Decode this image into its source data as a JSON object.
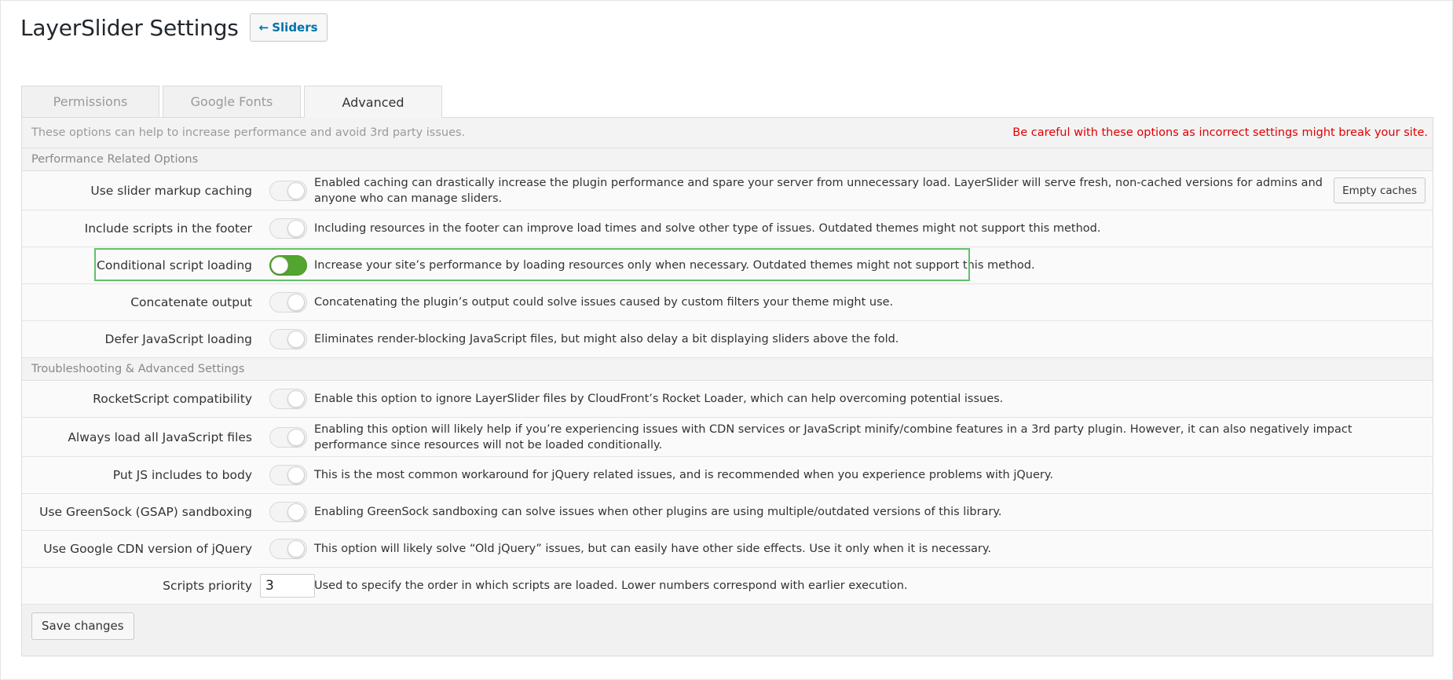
{
  "header": {
    "title": "LayerSlider Settings",
    "back_label": "Sliders",
    "back_arrow": "←"
  },
  "tabs": [
    {
      "label": "Permissions",
      "active": false
    },
    {
      "label": "Google Fonts",
      "active": false
    },
    {
      "label": "Advanced",
      "active": true
    }
  ],
  "notice": {
    "info": "These options can help to increase performance and avoid 3rd party issues.",
    "warning": "Be careful with these options as incorrect settings might break your site.",
    "warning_color": "#e00000"
  },
  "sections": {
    "performance": "Performance Related Options",
    "troubleshooting": "Troubleshooting & Advanced Settings"
  },
  "performance_rows": [
    {
      "label": "Use slider markup caching",
      "on": false,
      "desc": "Enabled caching can drastically increase the plugin performance and spare your server from unnecessary load. LayerSlider will serve fresh, non-cached versions for admins and anyone who can manage sliders.",
      "button": "Empty caches"
    },
    {
      "label": "Include scripts in the footer",
      "on": false,
      "desc": "Including resources in the footer can improve load times and solve other type of issues. Outdated themes might not support this method."
    },
    {
      "label": "Conditional script loading",
      "on": true,
      "desc": "Increase your site’s performance by loading resources only when necessary. Outdated themes might not support this method.",
      "highlighted": true
    },
    {
      "label": "Concatenate output",
      "on": false,
      "desc": "Concatenating the plugin’s output could solve issues caused by custom filters your theme might use."
    },
    {
      "label": "Defer JavaScript loading",
      "on": false,
      "desc": "Eliminates render-blocking JavaScript files, but might also delay a bit displaying sliders above the fold."
    }
  ],
  "troubleshooting_rows": [
    {
      "label": "RocketScript compatibility",
      "on": false,
      "desc": "Enable this option to ignore LayerSlider files by CloudFront’s Rocket Loader, which can help overcoming potential issues."
    },
    {
      "label": "Always load all JavaScript files",
      "on": false,
      "desc": "Enabling this option will likely help if you’re experiencing issues with CDN services or JavaScript minify/combine features in a 3rd party plugin. However, it can also negatively impact performance since resources will not be loaded conditionally."
    },
    {
      "label": "Put JS includes to body",
      "on": false,
      "desc": "This is the most common workaround for jQuery related issues, and is recommended when you experience problems with jQuery."
    },
    {
      "label": "Use GreenSock (GSAP) sandboxing",
      "on": false,
      "desc": "Enabling GreenSock sandboxing can solve issues when other plugins are using multiple/outdated versions of this library."
    },
    {
      "label": "Use Google CDN version of jQuery",
      "on": false,
      "desc": "This option will likely solve “Old jQuery” issues, but can easily have other side effects. Use it only when it is necessary."
    }
  ],
  "priority": {
    "label": "Scripts priority",
    "value": "3",
    "desc": "Used to specify the order in which scripts are loaded. Lower numbers correspond with earlier execution."
  },
  "footer": {
    "save_label": "Save changes"
  },
  "colors": {
    "toggle_on": "#52a52e",
    "highlight": "#62c06a",
    "link": "#0073aa"
  }
}
